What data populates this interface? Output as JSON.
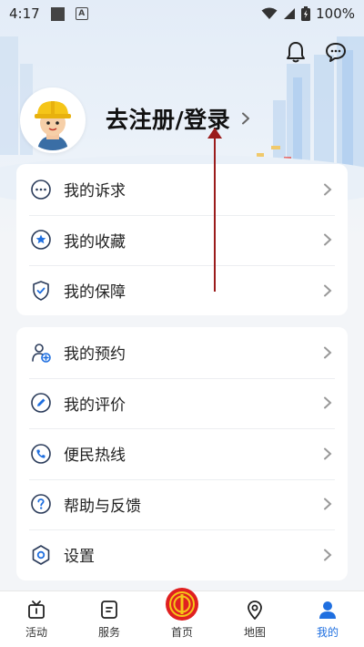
{
  "status_bar": {
    "time": "4:17",
    "notice_icon": "A",
    "battery": "100%"
  },
  "header": {
    "bell_icon": "bell-icon",
    "message_icon": "chat-icon"
  },
  "profile": {
    "login_label": "去注册/登录"
  },
  "menu_group_1": [
    {
      "label": "我的诉求",
      "icon": "chat-dots-icon"
    },
    {
      "label": "我的收藏",
      "icon": "star-icon"
    },
    {
      "label": "我的保障",
      "icon": "shield-icon"
    }
  ],
  "menu_group_2": [
    {
      "label": "我的预约",
      "icon": "user-add-icon"
    },
    {
      "label": "我的评价",
      "icon": "pencil-icon"
    },
    {
      "label": "便民热线",
      "icon": "phone-icon"
    },
    {
      "label": "帮助与反馈",
      "icon": "help-icon"
    },
    {
      "label": "设置",
      "icon": "settings-icon"
    }
  ],
  "bottom_nav": [
    {
      "label": "活动"
    },
    {
      "label": "服务"
    },
    {
      "label": "首页"
    },
    {
      "label": "地图"
    },
    {
      "label": "我的"
    }
  ],
  "colors": {
    "accent": "#1f6fe0",
    "home_badge": "#e02020",
    "annotation_arrow": "#9b1c1c"
  }
}
